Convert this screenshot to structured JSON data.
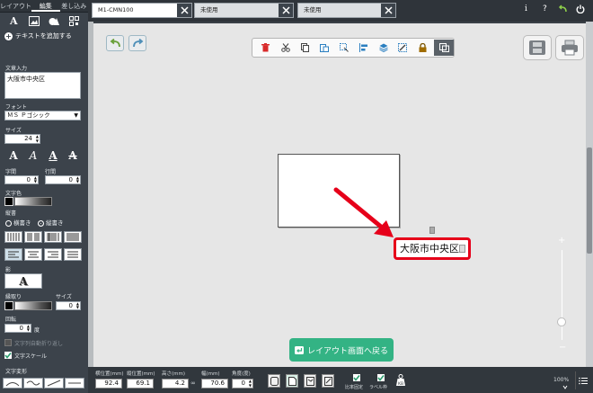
{
  "sidebar": {
    "tabs": [
      "レイアウト",
      "編集",
      "差し込み"
    ],
    "add_text": "テキストを追加する",
    "text_input_label": "文章入力",
    "text_input_value": "大阪市中央区",
    "font_label": "フォント",
    "font_value": "ＭＳ Ｐゴシック",
    "size_label": "サイズ",
    "size_value": "24",
    "char_spacing_label": "字間",
    "char_spacing_value": "0",
    "line_spacing_label": "行間",
    "line_spacing_value": "0",
    "text_color_label": "文字色",
    "direction_label": "縦書",
    "direction_options": [
      "横書き",
      "縦書き"
    ],
    "shadow_label": "影",
    "outline_label": "縁取り",
    "outline_size_label": "サイズ",
    "outline_size_value": "0",
    "rotate_label": "回転",
    "rotate_value": "0",
    "rotate_unit": "度",
    "auto_wrap_label": "文字列自動折り返し",
    "text_scale_label": "文字スケール",
    "text_warp_label": "文字変形"
  },
  "tabs": [
    {
      "label": "M1-CMN100",
      "active": true
    },
    {
      "label": "未使用",
      "active": false
    },
    {
      "label": "未使用",
      "active": false
    }
  ],
  "header_icons": [
    "info-icon",
    "help-icon",
    "undo-arrow-icon",
    "power-icon"
  ],
  "canvas": {
    "text_object": "大阪市中央区",
    "back_button": "レイアウト画面へ戻る"
  },
  "zoom": {
    "value": "100%",
    "level": 0.2
  },
  "bottom": {
    "x_label": "横位置(mm)",
    "x_value": "92.4",
    "y_label": "縦位置(mm)",
    "y_value": "69.1",
    "h_label": "高さ(mm)",
    "h_value": "4.2",
    "w_label": "幅(mm)",
    "w_value": "70.6",
    "angle_label": "角度(度)",
    "angle_value": "0",
    "fix_ratio_label": "比率固定",
    "label_frame_label": "ラベル枠"
  },
  "colors": {
    "accent_red": "#e6001a",
    "button_green": "#33b384"
  }
}
